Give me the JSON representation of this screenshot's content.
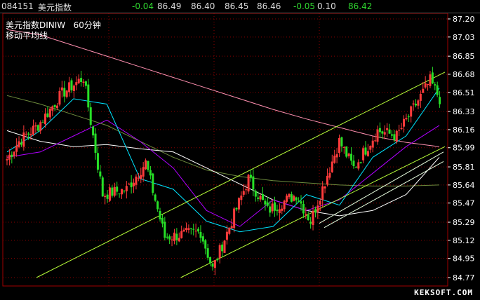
{
  "quote_bar": {
    "code": "084151",
    "name": "美元指数",
    "change1": "-0.04",
    "price1": "86.49",
    "price2": "86.40",
    "price3": "86.45",
    "price4": "86.46",
    "change2": "-0.05",
    "value5": "0.10",
    "value6": "86.42"
  },
  "title": {
    "line1_name": "美元指数DINIW",
    "line1_period": "60分钟",
    "line2": "移动平均线"
  },
  "watermark": "KEKSOFT.COM",
  "colors": {
    "background": "#000000",
    "up_candle": "#ff3b3b",
    "down_candle": "#27e027",
    "grid": "#8b0000",
    "ma_fast": "#00e5ff",
    "ma_slow": "#ffffff",
    "ma_purple": "#b000ff",
    "ma_olive": "#6e8b3d",
    "ma_pink": "#ff8fb0",
    "channel": "#b8ff3a"
  },
  "chart_data": {
    "type": "candlestick",
    "y_ticks": [
      "87.20",
      "87.03",
      "86.85",
      "86.68",
      "86.51",
      "86.33",
      "86.16",
      "85.99",
      "85.81",
      "85.64",
      "85.47",
      "85.29",
      "85.12",
      "84.95",
      "84.77"
    ],
    "ylim": [
      84.77,
      87.2
    ],
    "ohlc_series": [
      {
        "segment": "a",
        "from": 85.85,
        "to": 86.05,
        "count": 6
      },
      {
        "segment": "b",
        "from": 86.05,
        "to": 86.2,
        "count": 8
      },
      {
        "segment": "c",
        "from": 86.2,
        "to": 86.5,
        "count": 10
      },
      {
        "segment": "d",
        "from": 86.5,
        "to": 86.65,
        "count": 9
      },
      {
        "segment": "e",
        "from": 86.65,
        "to": 85.55,
        "count": 8
      },
      {
        "segment": "f",
        "from": 85.55,
        "to": 85.6,
        "count": 10
      },
      {
        "segment": "g",
        "from": 85.6,
        "to": 85.85,
        "count": 8
      },
      {
        "segment": "h",
        "from": 85.85,
        "to": 85.15,
        "count": 8
      },
      {
        "segment": "i",
        "from": 85.15,
        "to": 85.2,
        "count": 15
      },
      {
        "segment": "j",
        "from": 85.2,
        "to": 84.85,
        "count": 5
      },
      {
        "segment": "k",
        "from": 84.85,
        "to": 85.7,
        "count": 15
      },
      {
        "segment": "l",
        "from": 85.7,
        "to": 85.4,
        "count": 8
      },
      {
        "segment": "m",
        "from": 85.4,
        "to": 85.55,
        "count": 12
      },
      {
        "segment": "n",
        "from": 85.55,
        "to": 85.3,
        "count": 6
      },
      {
        "segment": "o",
        "from": 85.3,
        "to": 86.05,
        "count": 12
      },
      {
        "segment": "p",
        "from": 86.05,
        "to": 85.8,
        "count": 6
      },
      {
        "segment": "q",
        "from": 85.8,
        "to": 86.15,
        "count": 10
      },
      {
        "segment": "r",
        "from": 86.15,
        "to": 86.1,
        "count": 8
      },
      {
        "segment": "s",
        "from": 86.1,
        "to": 86.62,
        "count": 14
      },
      {
        "segment": "t",
        "from": 86.62,
        "to": 86.45,
        "count": 4
      }
    ],
    "moving_averages": [
      {
        "name": "ma_pink",
        "values": [
          87.1,
          87.05,
          86.95,
          86.85,
          86.75,
          86.65,
          86.55,
          86.45,
          86.35,
          86.26,
          86.18,
          86.1,
          86.04,
          86.0
        ]
      },
      {
        "name": "ma_olive",
        "values": [
          86.48,
          86.4,
          86.3,
          86.2,
          86.05,
          85.9,
          85.78,
          85.72,
          85.68,
          85.66,
          85.64,
          85.63,
          85.63,
          85.64
        ]
      },
      {
        "name": "ma_white",
        "values": [
          86.15,
          86.05,
          86.0,
          86.02,
          85.98,
          85.95,
          85.8,
          85.65,
          85.5,
          85.4,
          85.35,
          85.4,
          85.55,
          85.9
        ]
      },
      {
        "name": "ma_purple",
        "values": [
          85.9,
          85.95,
          86.1,
          86.25,
          86.05,
          85.8,
          85.4,
          85.25,
          85.5,
          85.4,
          85.5,
          85.75,
          86.0,
          86.2
        ]
      },
      {
        "name": "ma_cyan",
        "values": [
          85.95,
          86.15,
          86.45,
          86.4,
          85.7,
          85.6,
          85.3,
          85.2,
          85.25,
          85.55,
          85.45,
          85.9,
          86.1,
          86.55
        ]
      }
    ],
    "trend_channel": {
      "upper": {
        "from": [
          0,
          84.77
        ],
        "to": [
          1,
          86.7
        ]
      },
      "lower_a": {
        "from": [
          0.4,
          84.77
        ],
        "to": [
          1,
          86.0
        ]
      },
      "lower_b": {
        "from": [
          0.66,
          85.3
        ],
        "to": [
          1,
          85.95
        ]
      },
      "lower_c": {
        "from": [
          0.7,
          85.25
        ],
        "to": [
          1,
          85.85
        ]
      }
    },
    "grid": true
  }
}
